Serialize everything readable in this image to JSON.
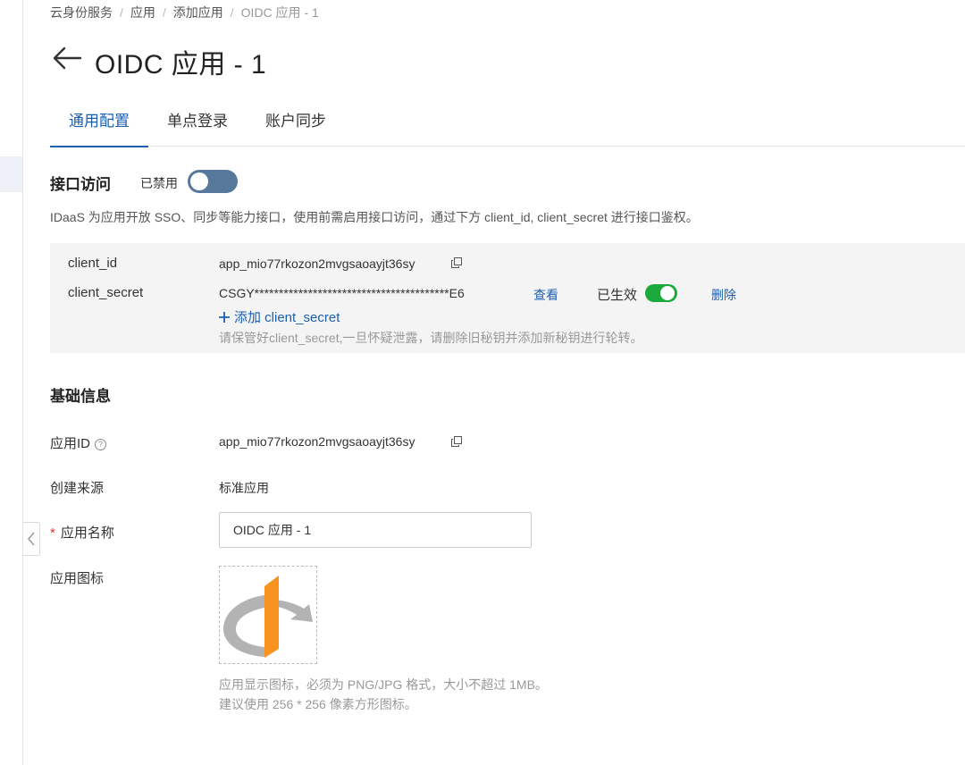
{
  "breadcrumb": [
    "云身份服务",
    "应用",
    "添加应用",
    "OIDC 应用 - 1"
  ],
  "page_title": "OIDC 应用 - 1",
  "tabs": [
    {
      "label": "通用配置",
      "active": true
    },
    {
      "label": "单点登录",
      "active": false
    },
    {
      "label": "账户同步",
      "active": false
    }
  ],
  "api_access": {
    "title": "接口访问",
    "status": "已禁用",
    "enabled": false,
    "description": "IDaaS 为应用开放 SSO、同步等能力接口，使用前需启用接口访问，通过下方 client_id, client_secret 进行接口鉴权。"
  },
  "credentials": {
    "client_id_label": "client_id",
    "client_id_value": "app_mio77rkozon2mvgsaoayjt36sy",
    "client_secret_label": "client_secret",
    "client_secret_value": "CSGY****************************************E6",
    "view_label": "查看",
    "secret_status": "已生效",
    "secret_enabled": true,
    "delete_label": "删除",
    "add_secret_label": "添加 client_secret",
    "secret_hint": "请保管好client_secret,一旦怀疑泄露，请删除旧秘钥并添加新秘钥进行轮转。"
  },
  "basic_info": {
    "title": "基础信息",
    "app_id_label": "应用ID",
    "app_id_value": "app_mio77rkozon2mvgsaoayjt36sy",
    "source_label": "创建来源",
    "source_value": "标准应用",
    "required_mark": "*",
    "name_label": "应用名称",
    "name_value": "OIDC 应用 - 1",
    "icon_label": "应用图标",
    "icon_hint_1": "应用显示图标，必须为 PNG/JPG 格式，大小不超过 1MB。",
    "icon_hint_2": "建议使用 256 * 256 像素方形图标。"
  },
  "colors": {
    "accent": "#1b5fb0",
    "toggle_off": "#56789b",
    "toggle_on": "#1aaa3b",
    "openid_orange": "#f7931e",
    "openid_gray": "#b3b3b3"
  },
  "icons": [
    "back-arrow-icon",
    "copy-icon",
    "help-icon",
    "plus-icon",
    "chevron-left-icon",
    "openid-logo-icon"
  ]
}
